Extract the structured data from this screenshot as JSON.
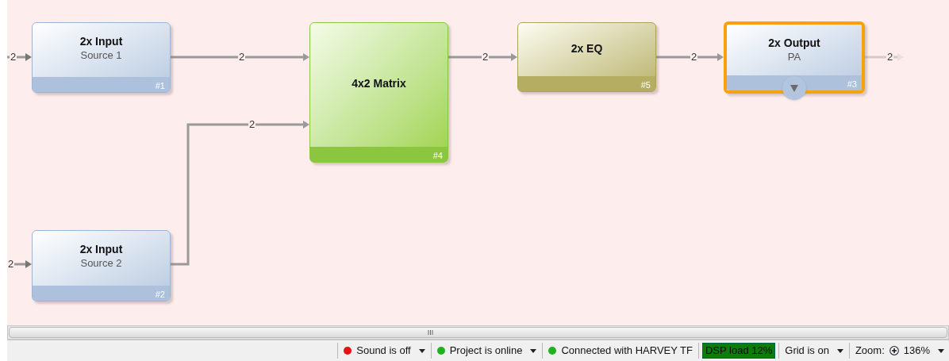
{
  "canvas": {
    "nodes": [
      {
        "kind": "input",
        "title": "2x Input",
        "subtitle": "Source 1",
        "number": "#1",
        "selected": false
      },
      {
        "kind": "input",
        "title": "2x Input",
        "subtitle": "Source 2",
        "number": "#2",
        "selected": false
      },
      {
        "kind": "matrix",
        "title": "4x2 Matrix",
        "number": "#4",
        "selected": false
      },
      {
        "kind": "eq",
        "title": "2x EQ",
        "number": "#5",
        "selected": false
      },
      {
        "kind": "output",
        "title": "2x Output",
        "subtitle": "PA",
        "number": "#3",
        "selected": true
      }
    ],
    "connections": [
      {
        "label": "2"
      },
      {
        "label": "2"
      },
      {
        "label": "2"
      },
      {
        "label": "2"
      },
      {
        "label": "2"
      },
      {
        "label": "2"
      },
      {
        "label": "2"
      }
    ]
  },
  "status_bar": {
    "items": [
      {
        "kind": "status",
        "text": "Sound is off",
        "color": "#e81010",
        "dropdown": true
      },
      {
        "kind": "status",
        "text": "Project is online",
        "color": "#20b020",
        "dropdown": true
      },
      {
        "kind": "status",
        "text": "Connected with HARVEY TF",
        "color": "#20b020",
        "dropdown": false
      },
      {
        "kind": "load",
        "text": "DSP load 12%"
      },
      {
        "kind": "plain",
        "text": "Grid is on",
        "dropdown": true
      },
      {
        "kind": "zoom",
        "label": "Zoom:",
        "text": "136%",
        "dropdown": true
      }
    ]
  }
}
